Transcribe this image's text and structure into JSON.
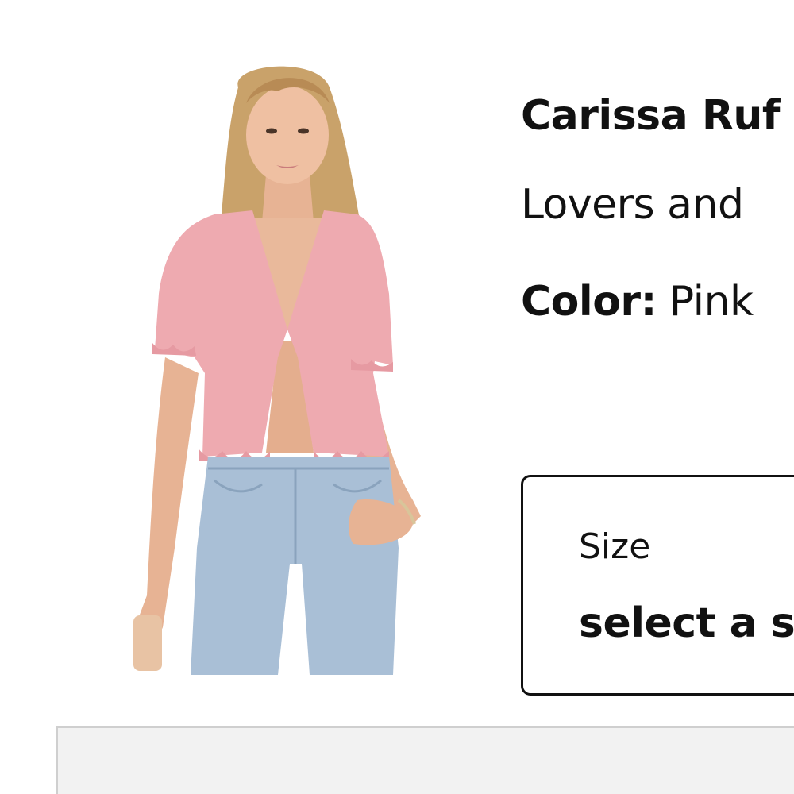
{
  "product": {
    "title": "Carissa Ruf",
    "brand": "Lovers and",
    "color_label": "Color:",
    "color_value": "Pink",
    "image_icon": "product-photo"
  },
  "size_selector": {
    "label": "Size",
    "value": "select a s"
  },
  "colors": {
    "text": "#111111",
    "border": "#111111",
    "panel_bg": "#f2f2f2",
    "panel_border": "#cfcfcf",
    "top_pink": "#eeaab0",
    "denim": "#a9bfd6"
  }
}
